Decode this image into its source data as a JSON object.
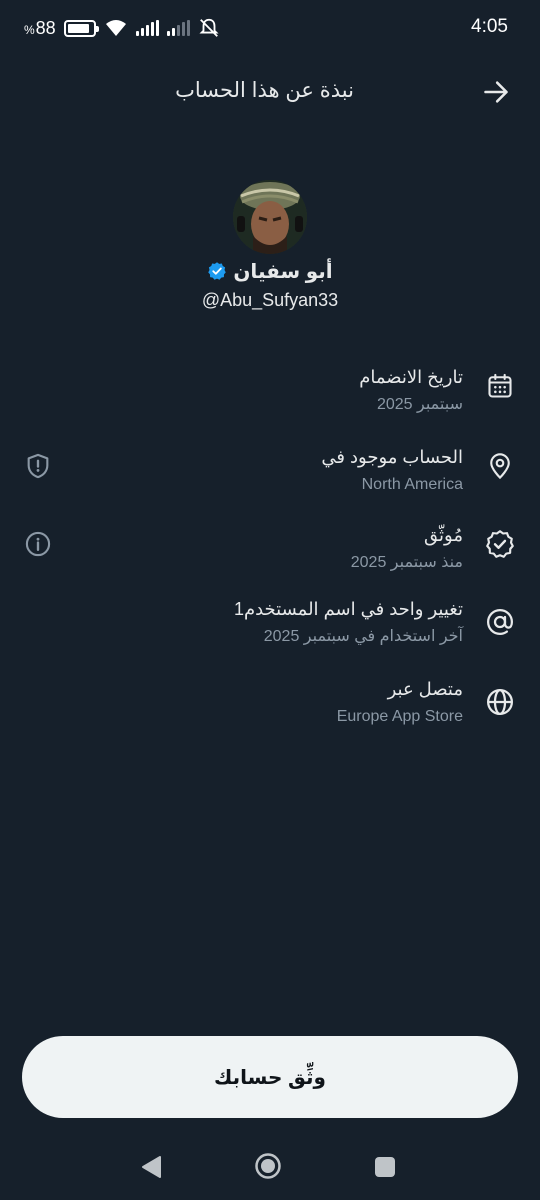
{
  "status_bar": {
    "battery": "88",
    "battery_pct_symbol": "%",
    "time": "4:05"
  },
  "header": {
    "title": "نبذة عن هذا الحساب",
    "back_icon": "arrow-right-icon"
  },
  "profile": {
    "display_name": "أبو سفيان",
    "handle": "@Abu_Sufyan33",
    "verified": true,
    "verified_color": "#1d9bf0"
  },
  "info_rows": [
    {
      "icon": "calendar-icon",
      "title": "تاريخ الانضمام",
      "subtitle": "سبتمبر 2025"
    },
    {
      "icon": "location-pin-icon",
      "title": "الحساب موجود في",
      "subtitle": "North America",
      "left_icon": "shield-icon"
    },
    {
      "icon": "verified-seal-icon",
      "title": "مُوثّق",
      "subtitle": "منذ سبتمبر 2025",
      "left_icon": "info-icon"
    },
    {
      "icon": "at-sign-icon",
      "title": "تغيير واحد في اسم المستخدم1",
      "subtitle": "آخر استخدام في سبتمبر 2025"
    },
    {
      "icon": "globe-icon",
      "title": "متصل عبر",
      "subtitle": "Europe App Store"
    }
  ],
  "verify_button": {
    "label": "وثِّق حسابك"
  },
  "colors": {
    "background": "#16202b",
    "text_primary": "#e7e9ea",
    "text_secondary": "#8b98a5",
    "button_bg": "#eff3f4"
  }
}
